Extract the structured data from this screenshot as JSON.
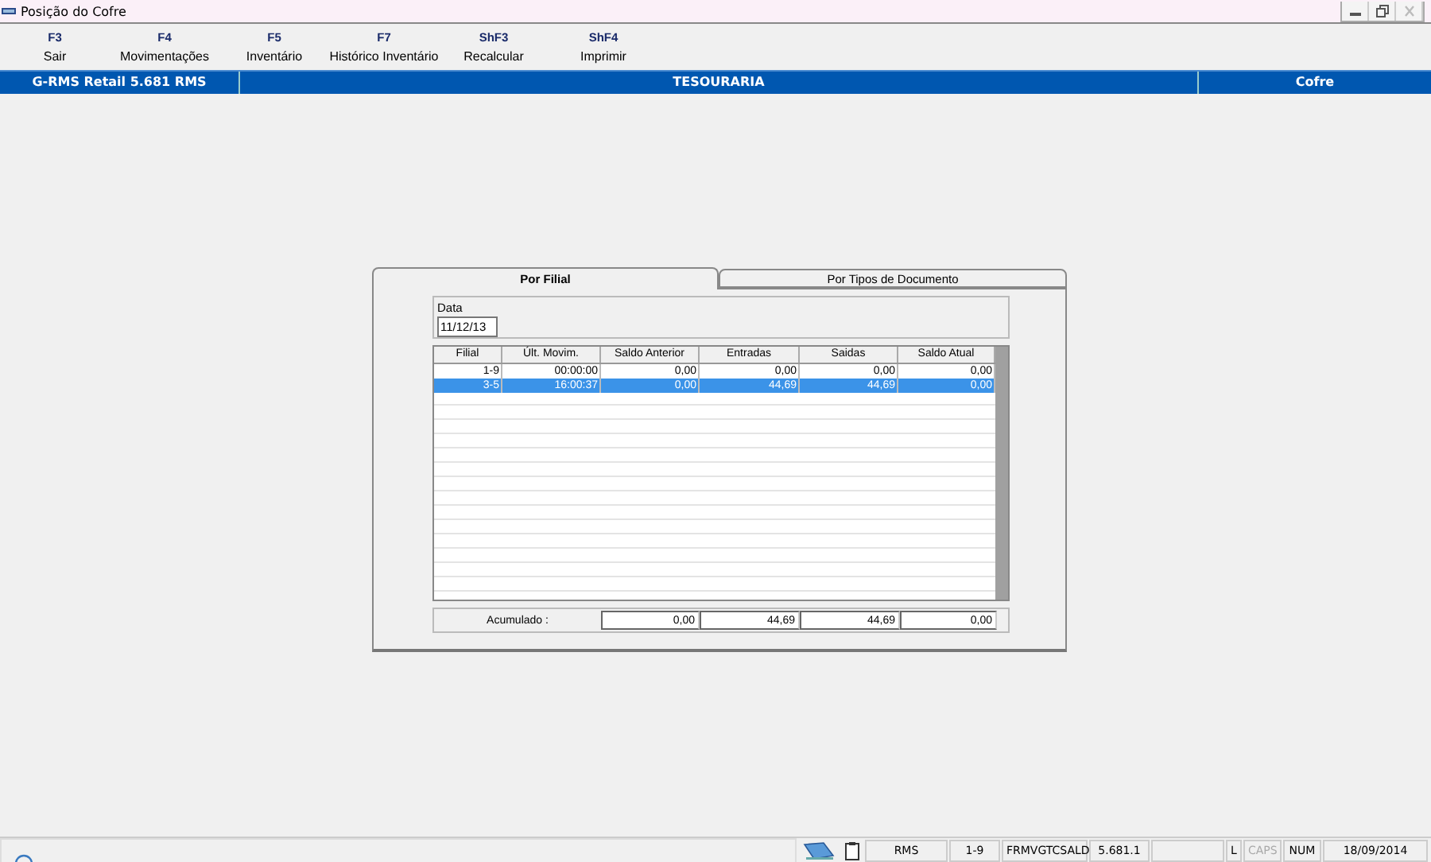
{
  "window": {
    "title": "Posição do Cofre"
  },
  "toolbar": [
    {
      "key": "F3",
      "label": "Sair"
    },
    {
      "key": "F4",
      "label": "Movimentações"
    },
    {
      "key": "F5",
      "label": "Inventário"
    },
    {
      "key": "F7",
      "label": "Histórico Inventário"
    },
    {
      "key": "ShF3",
      "label": "Recalcular"
    },
    {
      "key": "ShF4",
      "label": "Imprimir"
    }
  ],
  "header": {
    "left": "G-RMS Retail 5.681 RMS",
    "center": "TESOURARIA",
    "right": "Cofre"
  },
  "tabs": [
    {
      "label": "Por Filial",
      "selected": true
    },
    {
      "label": "Por Tipos de Documento",
      "selected": false
    }
  ],
  "date_field": {
    "label": "Data",
    "value": "11/12/13"
  },
  "table": {
    "columns": [
      "Filial",
      "Últ. Movim.",
      "Saldo Anterior",
      "Entradas",
      "Saidas",
      "Saldo Atual"
    ],
    "rows": [
      {
        "cells": [
          "1-9",
          "00:00:00",
          "0,00",
          "0,00",
          "0,00",
          "0,00"
        ],
        "selected": false
      },
      {
        "cells": [
          "3-5",
          "16:00:37",
          "0,00",
          "44,69",
          "44,69",
          "0,00"
        ],
        "selected": true
      }
    ]
  },
  "totals": {
    "label": "Acumulado :",
    "values": [
      "0,00",
      "44,69",
      "44,69",
      "0,00"
    ]
  },
  "status_bar": {
    "panes": [
      {
        "text": "RMS",
        "disabled": false
      },
      {
        "text": "1-9",
        "disabled": false
      },
      {
        "text": "FRMVGTCSALD",
        "disabled": false
      },
      {
        "text": "5.681.1",
        "disabled": false
      },
      {
        "text": "L",
        "disabled": false
      },
      {
        "text": "CAPS",
        "disabled": true
      },
      {
        "text": "NUM",
        "disabled": false
      },
      {
        "text": "18/09/2014",
        "disabled": false
      }
    ]
  }
}
